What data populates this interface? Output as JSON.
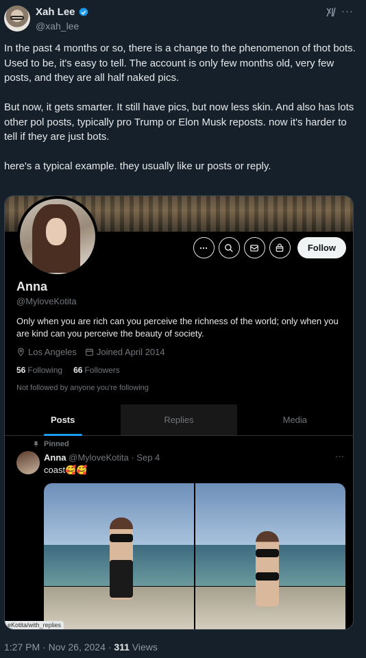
{
  "author": {
    "name": "Xah Lee",
    "handle": "@xah_lee",
    "verified": true
  },
  "tweet": {
    "text": "In the past 4 months or so, there is a change to the phenomenon of thot bots.\nUsed to be, it's easy to tell. The account is only few months old, very few posts, and they are all half naked pics.\n\nBut now, it gets smarter. It still have pics, but now less skin. And also has lots other pol posts, typically pro Trump or Elon Musk reposts. now it's harder to tell if they are just bots.\n\nhere's a typical example. they usually like ur posts or reply."
  },
  "profile": {
    "name": "Anna",
    "handle": "@MyloveKotita",
    "bio": "Only when you are rich can you perceive the richness of the world; only when you are kind can you perceive the beauty of society.",
    "location": "Los Angeles",
    "joined": "Joined April 2014",
    "following_count": "56",
    "following_label": "Following",
    "followers_count": "66",
    "followers_label": "Followers",
    "not_followed": "Not followed by anyone you're following",
    "follow_button": "Follow"
  },
  "tabs": [
    {
      "label": "Posts",
      "active": true
    },
    {
      "label": "Replies",
      "active": false
    },
    {
      "label": "Media",
      "active": false
    }
  ],
  "pinned_post": {
    "pinned_label": "Pinned",
    "author": "Anna",
    "handle_date": "@MyloveKotita · Sep 4",
    "text": "coast🥰🥰",
    "watermark": "eKotita/with_replies"
  },
  "footer": {
    "time": "1:27 PM · Nov 26, 2024 · ",
    "views_count": "311",
    "views_label": " Views"
  },
  "colors": {
    "background": "#15202b",
    "accent": "#1d9bf0",
    "verified": "#1d9bf0"
  }
}
